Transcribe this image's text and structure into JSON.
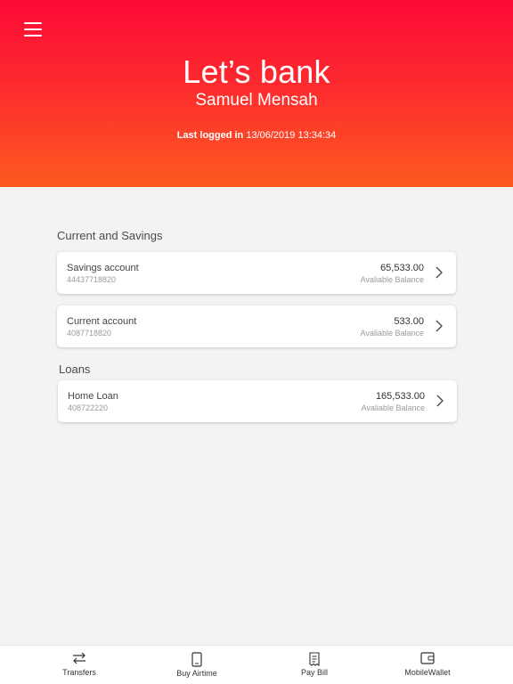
{
  "header": {
    "title": "Let’s bank",
    "user_name": "Samuel Mensah",
    "last_logged_label": "Last logged in",
    "last_logged_value": "13/06/2019 13:34:34"
  },
  "sections": {
    "current_savings_title": "Current and Savings",
    "loans_title": "Loans"
  },
  "accounts": [
    {
      "name": "Savings account",
      "number": "44437718820",
      "amount": "65,533.00",
      "balance_label": "Avaliable Balance"
    },
    {
      "name": "Current account",
      "number": "4087718820",
      "amount": "533.00",
      "balance_label": "Avaliable Balance"
    },
    {
      "name": "Home Loan",
      "number": "408722220",
      "amount": "165,533.00",
      "balance_label": "Avaliable Balance"
    }
  ],
  "tabs": [
    {
      "label": "Transfers",
      "icon": "transfer-arrows-icon"
    },
    {
      "label": "Buy Airtime",
      "icon": "phone-icon"
    },
    {
      "label": "Pay Bill",
      "icon": "bill-icon"
    },
    {
      "label": "MobileWallet",
      "icon": "wallet-icon"
    }
  ],
  "colors": {
    "header_top": "#fd0a37",
    "header_bottom": "#fd5a20",
    "background": "#f4f3f2"
  }
}
